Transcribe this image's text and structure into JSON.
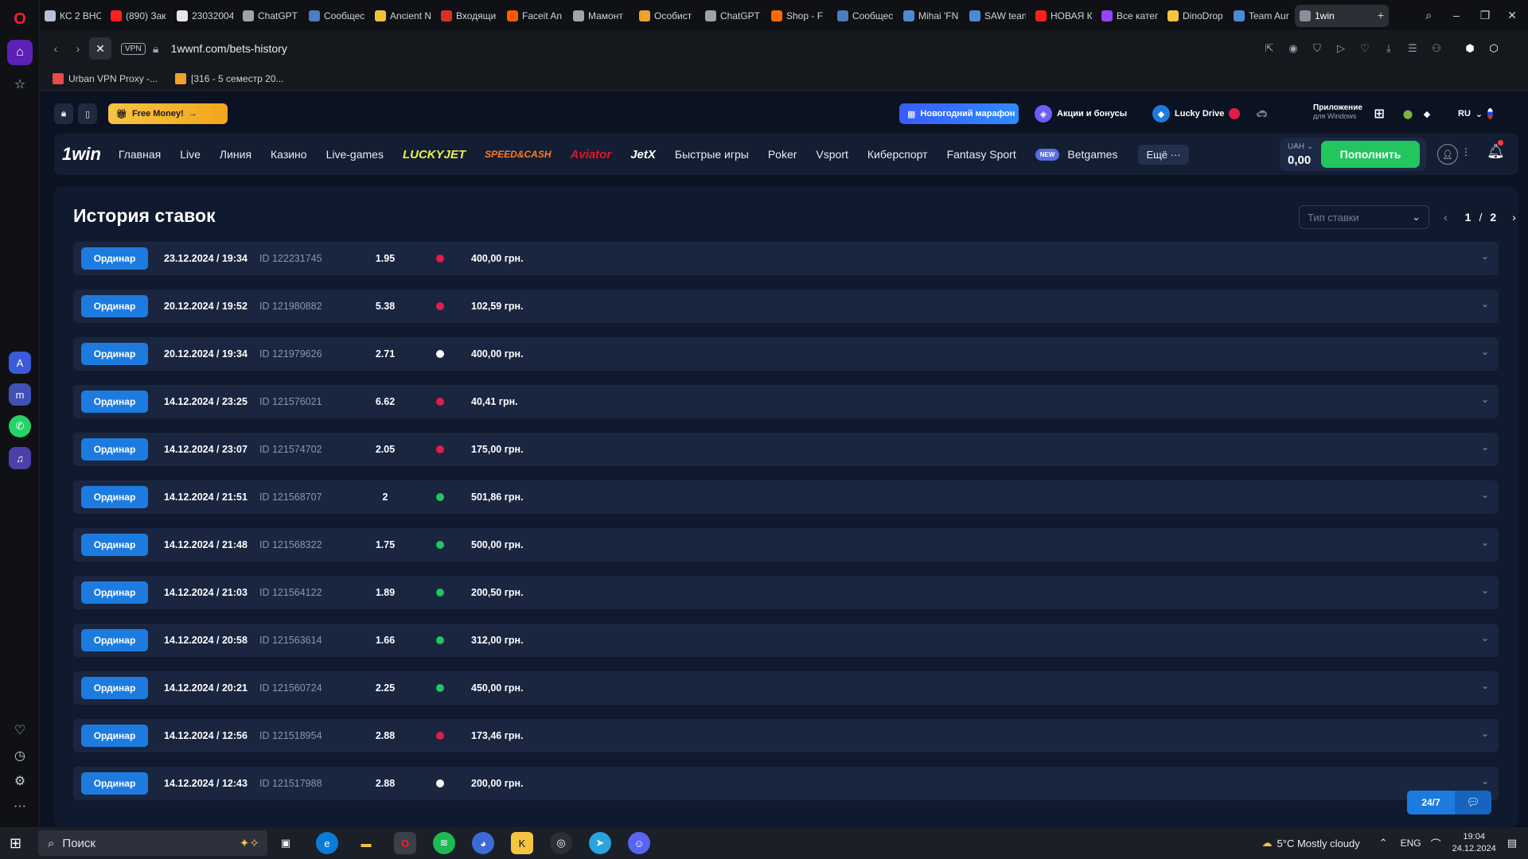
{
  "browser": {
    "tabs": [
      {
        "label": "КС 2 ВНС",
        "color": "#b8c2d6"
      },
      {
        "label": "(890) Зак",
        "color": "#ff1f1f"
      },
      {
        "label": "23032004",
        "color": "#e6e6e6"
      },
      {
        "label": "ChatGPT",
        "color": "#9da3ad"
      },
      {
        "label": "Сообщес",
        "color": "#4b7dbf"
      },
      {
        "label": "Ancient N",
        "color": "#f0c23a"
      },
      {
        "label": "Входящи",
        "color": "#d93025"
      },
      {
        "label": "Faceit An",
        "color": "#ff5a00"
      },
      {
        "label": "Мамонт",
        "color": "#9fa5af"
      },
      {
        "label": "Особист",
        "color": "#f0a12a"
      },
      {
        "label": "ChatGPT",
        "color": "#9da3ad"
      },
      {
        "label": "Shop - F",
        "color": "#ff6a00"
      },
      {
        "label": "Сообщес",
        "color": "#4b7dbf"
      },
      {
        "label": "Mihai 'FN",
        "color": "#4b8bd6"
      },
      {
        "label": "SAW tean",
        "color": "#4b8bd6"
      },
      {
        "label": "НОВАЯ К",
        "color": "#ff1f1f"
      },
      {
        "label": "Все катег",
        "color": "#9146ff"
      },
      {
        "label": "DinoDrop",
        "color": "#f5c542"
      },
      {
        "label": "Team Aur",
        "color": "#4b8bd6"
      },
      {
        "label": "1win",
        "color": "#8a8f99",
        "active": true
      }
    ],
    "vpn_label": "VPN",
    "url": "1wwnf.com/bets-history",
    "bookmarks": [
      {
        "label": "Urban VPN Proxy -...",
        "color": "#e64a4a"
      },
      {
        "label": "[316 - 5 семестр 20...",
        "color": "#f0a12a"
      }
    ]
  },
  "site": {
    "promo": {
      "free_money": "Free Money!",
      "marathon": "Новогодний марафон",
      "promotions": "Акции и бонусы",
      "lucky_drive": "Lucky Drive",
      "app_title": "Приложение",
      "app_subtitle": "для Windows",
      "lang": "RU"
    },
    "nav": {
      "logo": "1win",
      "items": [
        "Главная",
        "Live",
        "Линия",
        "Казино",
        "Live-games"
      ],
      "brands": [
        {
          "label": "LUCKYJET",
          "color": "#e7f04a"
        },
        {
          "label": "SPEED&CASH",
          "color": "#ff7b24"
        },
        {
          "label": "Aviator",
          "color": "#e1162b"
        },
        {
          "label": "JetX",
          "color": "#ffffff"
        }
      ],
      "items2": [
        "Быстрые игры",
        "Poker",
        "Vsport",
        "Киберспорт",
        "Fantasy Sport"
      ],
      "new_badge": "NEW",
      "betgames": "Betgames",
      "more": "Ещё ···",
      "currency": "UAH ⌄",
      "balance": "0,00",
      "deposit": "Пополнить"
    },
    "page": {
      "title": "История ставок",
      "bet_type_placeholder": "Тип ставки",
      "page_current": "1",
      "page_sep": "/",
      "page_total": "2"
    },
    "status_colors": {
      "lost": "#e11d48",
      "won": "#22c55e",
      "returned": "#ffffff"
    },
    "bets": [
      {
        "type": "Ординар",
        "date": "23.12.2024 / 19:34",
        "id": "ID 122231745",
        "coef": "1.95",
        "status": "lost",
        "amount": "400,00 грн."
      },
      {
        "type": "Ординар",
        "date": "20.12.2024 / 19:52",
        "id": "ID 121980882",
        "coef": "5.38",
        "status": "lost",
        "amount": "102,59 грн."
      },
      {
        "type": "Ординар",
        "date": "20.12.2024 / 19:34",
        "id": "ID 121979626",
        "coef": "2.71",
        "status": "returned",
        "amount": "400,00 грн."
      },
      {
        "type": "Ординар",
        "date": "14.12.2024 / 23:25",
        "id": "ID 121576021",
        "coef": "6.62",
        "status": "lost",
        "amount": "40,41 грн."
      },
      {
        "type": "Ординар",
        "date": "14.12.2024 / 23:07",
        "id": "ID 121574702",
        "coef": "2.05",
        "status": "lost",
        "amount": "175,00 грн."
      },
      {
        "type": "Ординар",
        "date": "14.12.2024 / 21:51",
        "id": "ID 121568707",
        "coef": "2",
        "status": "won",
        "amount": "501,86 грн."
      },
      {
        "type": "Ординар",
        "date": "14.12.2024 / 21:48",
        "id": "ID 121568322",
        "coef": "1.75",
        "status": "won",
        "amount": "500,00 грн."
      },
      {
        "type": "Ординар",
        "date": "14.12.2024 / 21:03",
        "id": "ID 121564122",
        "coef": "1.89",
        "status": "won",
        "amount": "200,50 грн."
      },
      {
        "type": "Ординар",
        "date": "14.12.2024 / 20:58",
        "id": "ID 121563614",
        "coef": "1.66",
        "status": "won",
        "amount": "312,00 грн."
      },
      {
        "type": "Ординар",
        "date": "14.12.2024 / 20:21",
        "id": "ID 121560724",
        "coef": "2.25",
        "status": "won",
        "amount": "450,00 грн."
      },
      {
        "type": "Ординар",
        "date": "14.12.2024 / 12:56",
        "id": "ID 121518954",
        "coef": "2.88",
        "status": "lost",
        "amount": "173,46 грн."
      },
      {
        "type": "Ординар",
        "date": "14.12.2024 / 12:43",
        "id": "ID 121517988",
        "coef": "2.88",
        "status": "returned",
        "amount": "200,00 грн."
      }
    ],
    "support_label": "24/7"
  },
  "taskbar": {
    "search_label": "Поиск",
    "weather": "5°C  Mostly cloudy",
    "lang": "ENG",
    "time": "19:04",
    "date": "24.12.2024"
  }
}
